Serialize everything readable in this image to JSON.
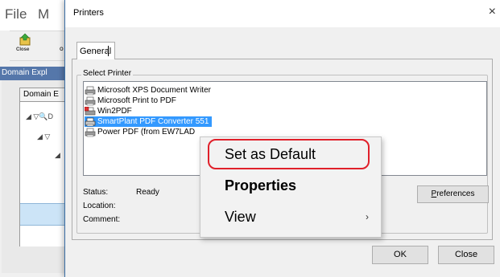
{
  "background_app": {
    "menu": [
      "File",
      "M"
    ],
    "toolbar": {
      "close_label": "Close",
      "cut_label": "O"
    },
    "panel_title": "Domain Expl",
    "tab_label": "Domain E",
    "tree_row_1": "◢ ▽🔍D",
    "tree_row_2": "◢ ▽",
    "tree_row_3": "◢"
  },
  "dialog": {
    "title": "Printers",
    "close_glyph": "×",
    "tab": "General",
    "group_label": "Select Printer",
    "printers": [
      {
        "name": "Microsoft XPS Document Writer",
        "selected": false,
        "icon": "printer-icon"
      },
      {
        "name": "Microsoft Print to PDF",
        "selected": false,
        "icon": "printer-icon"
      },
      {
        "name": "Win2PDF",
        "selected": false,
        "icon": "pdf-printer-icon"
      },
      {
        "name": "SmartPlant PDF Converter 551",
        "selected": true,
        "icon": "printer-icon"
      },
      {
        "name": "Power PDF (from EW7LAD",
        "selected": false,
        "icon": "printer-icon"
      }
    ],
    "status_label": "Status:",
    "status_value": "Ready",
    "location_label": "Location:",
    "comment_label": "Comment:",
    "preferences_first": "P",
    "preferences_rest": "references",
    "ok_label": "OK",
    "close_label": "Close"
  },
  "context_menu": {
    "items": [
      {
        "label": "Set as Default",
        "bold": false,
        "submenu": false
      },
      {
        "label": "Properties",
        "bold": true,
        "submenu": false
      },
      {
        "label": "View",
        "bold": false,
        "submenu": true
      }
    ],
    "submenu_glyph": "›"
  },
  "colors": {
    "selection": "#3399ff",
    "highlight_ring": "#e0202a",
    "dialog_bg": "#f0f0f0"
  }
}
